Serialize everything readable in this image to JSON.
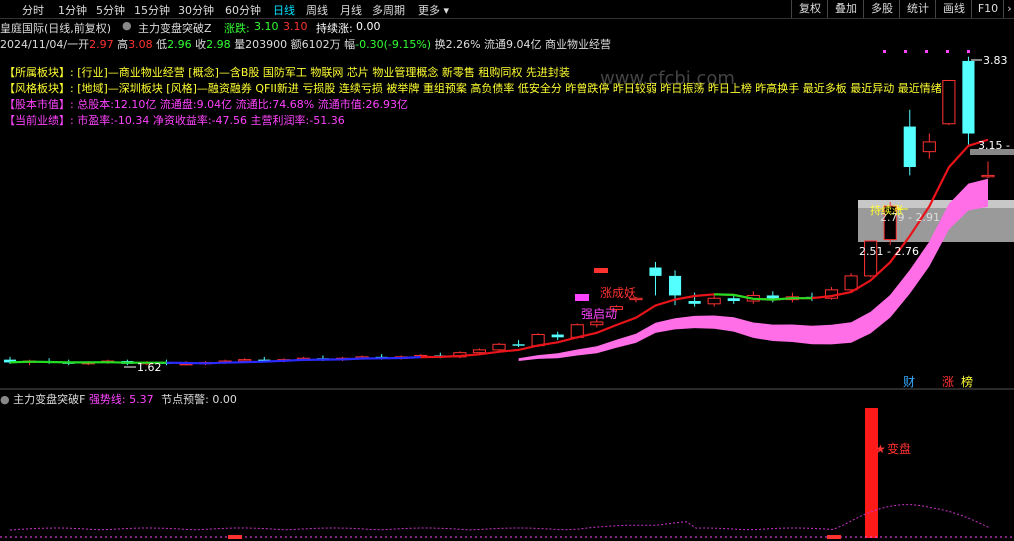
{
  "toolbar": {
    "timeframes": [
      "分时",
      "1分钟",
      "5分钟",
      "15分钟",
      "30分钟",
      "60分钟",
      "日线",
      "周线",
      "月线",
      "多周期",
      "更多"
    ],
    "active": "日线",
    "right_buttons": [
      "复权",
      "叠加",
      "多股",
      "统计",
      "画线",
      "F10"
    ]
  },
  "title": {
    "stock": "皇庭国际(日线,前复权)",
    "indicator": "主力变盘突破Z",
    "rise_label": "涨跌:",
    "rise_value": "3.10",
    "rise_value2": "3.10",
    "continue_label": "持续涨:",
    "continue_value": "0.00"
  },
  "ohlc": {
    "date": "2024/11/04/一",
    "open_label": "开",
    "open": "2.97",
    "high_label": "高",
    "high": "3.08",
    "low_label": "低",
    "low": "2.96",
    "close_label": "收",
    "close": "2.98",
    "vol_label": "量",
    "vol": "203900",
    "amount_label": "额",
    "amount": "6102万",
    "change_label": "幅",
    "change": "-0.30(-9.15%)",
    "turnover": "换2.26%",
    "float_cap": "流通9.04亿",
    "industry": "商业物业经营"
  },
  "info": [
    {
      "label": "【所属板块】:",
      "value": "[行业]—商业物业经营 [概念]—含B股 国防军工 物联网 芯片 物业管理概念 新零售 租购同权 先进封装",
      "color": "yellow"
    },
    {
      "label": "【风格板块】:",
      "value": "[地域]—深圳板块 [风格]—融资融券 QFII新进 亏损股 连续亏损 被举牌 重组预案 高负债率 低安全分 昨曾跌停 昨日较弱 昨日振荡 昨日上榜 昨高换手 最近多板 最近异动 最近情绪",
      "color": "yellow"
    },
    {
      "label": "【股本市值】:",
      "value": "总股本:12.10亿 流通盘:9.04亿 流通比:74.68% 流通市值:26.93亿",
      "color": "pink"
    },
    {
      "label": "【当前业绩】:",
      "value": "市盈率:-10.34 净资收益率:-47.56 主营利润率:-51.36",
      "color": "pink"
    }
  ],
  "annotations": {
    "high_price": "3.83",
    "low_price": "1.62",
    "range_top": "3.15 - 3",
    "range_mid": "2.51 - 2.76",
    "range_gray": "2.79 - 2.91",
    "continue_tag": "持续涨",
    "zhang_cheng_yao": "涨成妖",
    "qiang_qi_dong": "强启动",
    "tags": [
      "财",
      "涨",
      "榜"
    ],
    "watermark": "www.cfcbi.com"
  },
  "lower": {
    "name": "主力变盘突破F",
    "strong_label": "强势线:",
    "strong_value": "5.37",
    "node_label": "节点预警:",
    "node_value": "0.00",
    "bar_label": "变盘"
  },
  "colors": {
    "up": "#ff3232",
    "down": "#54ffff",
    "ma_red": "#e8141a",
    "ma_green": "#22dd22",
    "ma_blue": "#2a2aff",
    "band": "#ff6ee6",
    "yellow": "#ffff33",
    "pink": "#ff44ff"
  },
  "chart_data": {
    "type": "candlestick",
    "date_of_last": "2024/11/04",
    "price_range": [
      1.55,
      3.95
    ],
    "candles": [
      {
        "o": 1.66,
        "h": 1.68,
        "l": 1.63,
        "c": 1.64
      },
      {
        "o": 1.64,
        "h": 1.66,
        "l": 1.62,
        "c": 1.65
      },
      {
        "o": 1.65,
        "h": 1.67,
        "l": 1.63,
        "c": 1.64
      },
      {
        "o": 1.64,
        "h": 1.66,
        "l": 1.62,
        "c": 1.63
      },
      {
        "o": 1.63,
        "h": 1.65,
        "l": 1.62,
        "c": 1.64
      },
      {
        "o": 1.64,
        "h": 1.66,
        "l": 1.63,
        "c": 1.65
      },
      {
        "o": 1.65,
        "h": 1.66,
        "l": 1.62,
        "c": 1.63
      },
      {
        "o": 1.63,
        "h": 1.65,
        "l": 1.62,
        "c": 1.64
      },
      {
        "o": 1.64,
        "h": 1.66,
        "l": 1.62,
        "c": 1.63
      },
      {
        "o": 1.63,
        "h": 1.65,
        "l": 1.62,
        "c": 1.63
      },
      {
        "o": 1.63,
        "h": 1.65,
        "l": 1.62,
        "c": 1.64
      },
      {
        "o": 1.64,
        "h": 1.66,
        "l": 1.63,
        "c": 1.65
      },
      {
        "o": 1.65,
        "h": 1.67,
        "l": 1.64,
        "c": 1.66
      },
      {
        "o": 1.66,
        "h": 1.68,
        "l": 1.64,
        "c": 1.65
      },
      {
        "o": 1.65,
        "h": 1.67,
        "l": 1.64,
        "c": 1.66
      },
      {
        "o": 1.66,
        "h": 1.68,
        "l": 1.65,
        "c": 1.67
      },
      {
        "o": 1.67,
        "h": 1.69,
        "l": 1.65,
        "c": 1.66
      },
      {
        "o": 1.66,
        "h": 1.68,
        "l": 1.65,
        "c": 1.67
      },
      {
        "o": 1.67,
        "h": 1.69,
        "l": 1.66,
        "c": 1.68
      },
      {
        "o": 1.68,
        "h": 1.7,
        "l": 1.66,
        "c": 1.67
      },
      {
        "o": 1.67,
        "h": 1.69,
        "l": 1.66,
        "c": 1.68
      },
      {
        "o": 1.68,
        "h": 1.7,
        "l": 1.67,
        "c": 1.69
      },
      {
        "o": 1.69,
        "h": 1.71,
        "l": 1.67,
        "c": 1.68
      },
      {
        "o": 1.68,
        "h": 1.72,
        "l": 1.67,
        "c": 1.71
      },
      {
        "o": 1.71,
        "h": 1.74,
        "l": 1.7,
        "c": 1.73
      },
      {
        "o": 1.73,
        "h": 1.78,
        "l": 1.72,
        "c": 1.77
      },
      {
        "o": 1.77,
        "h": 1.8,
        "l": 1.75,
        "c": 1.76
      },
      {
        "o": 1.76,
        "h": 1.85,
        "l": 1.75,
        "c": 1.84
      },
      {
        "o": 1.84,
        "h": 1.86,
        "l": 1.8,
        "c": 1.82
      },
      {
        "o": 1.82,
        "h": 1.92,
        "l": 1.81,
        "c": 1.91
      },
      {
        "o": 1.91,
        "h": 1.95,
        "l": 1.89,
        "c": 1.93
      },
      {
        "o": 2.02,
        "h": 2.05,
        "l": 2.0,
        "c": 2.04
      },
      {
        "o": 2.09,
        "h": 2.11,
        "l": 2.07,
        "c": 2.1
      },
      {
        "o": 2.32,
        "h": 2.36,
        "l": 2.12,
        "c": 2.26
      },
      {
        "o": 2.26,
        "h": 2.3,
        "l": 2.05,
        "c": 2.12
      },
      {
        "o": 2.08,
        "h": 2.14,
        "l": 2.04,
        "c": 2.06
      },
      {
        "o": 2.06,
        "h": 2.12,
        "l": 2.04,
        "c": 2.1
      },
      {
        "o": 2.1,
        "h": 2.13,
        "l": 2.06,
        "c": 2.08
      },
      {
        "o": 2.08,
        "h": 2.15,
        "l": 2.06,
        "c": 2.12
      },
      {
        "o": 2.12,
        "h": 2.15,
        "l": 2.07,
        "c": 2.09
      },
      {
        "o": 2.09,
        "h": 2.14,
        "l": 2.07,
        "c": 2.11
      },
      {
        "o": 2.11,
        "h": 2.14,
        "l": 2.08,
        "c": 2.1
      },
      {
        "o": 2.1,
        "h": 2.18,
        "l": 2.09,
        "c": 2.16
      },
      {
        "o": 2.16,
        "h": 2.28,
        "l": 2.14,
        "c": 2.26
      },
      {
        "o": 2.26,
        "h": 2.51,
        "l": 2.25,
        "c": 2.51
      },
      {
        "o": 2.52,
        "h": 2.79,
        "l": 2.48,
        "c": 2.76
      },
      {
        "o": 3.33,
        "h": 3.45,
        "l": 2.98,
        "c": 3.04
      },
      {
        "o": 3.15,
        "h": 3.28,
        "l": 3.1,
        "c": 3.22
      },
      {
        "o": 3.35,
        "h": 3.66,
        "l": 3.34,
        "c": 3.66
      },
      {
        "o": 3.8,
        "h": 3.83,
        "l": 3.2,
        "c": 3.28
      },
      {
        "o": 2.97,
        "h": 3.08,
        "l": 2.96,
        "c": 2.98
      }
    ],
    "strong_line": 5.37,
    "node_alert": 0.0
  }
}
